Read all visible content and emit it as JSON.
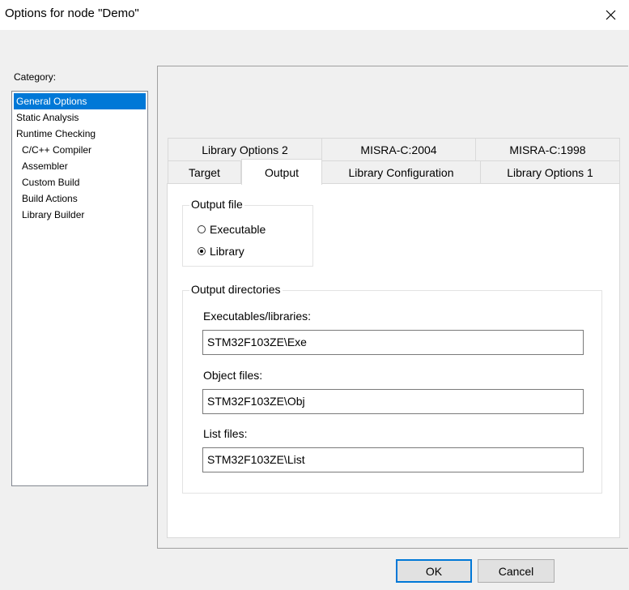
{
  "window": {
    "title": "Options for node \"Demo\""
  },
  "category": {
    "label": "Category:",
    "items": [
      {
        "label": "General Options",
        "selected": true
      },
      {
        "label": "Static Analysis"
      },
      {
        "label": "Runtime Checking"
      },
      {
        "label": "C/C++ Compiler"
      },
      {
        "label": "Assembler"
      },
      {
        "label": "Custom Build"
      },
      {
        "label": "Build Actions"
      },
      {
        "label": "Library Builder"
      }
    ]
  },
  "tabs": {
    "row_back": [
      "Library Options 2",
      "MISRA-C:2004",
      "MISRA-C:1998"
    ],
    "row_front": [
      "Target",
      "Output",
      "Library Configuration",
      "Library Options 1"
    ],
    "active": "Output"
  },
  "output_file": {
    "title": "Output file",
    "options": [
      "Executable",
      "Library"
    ],
    "selected": "Library"
  },
  "output_directories": {
    "title": "Output directories",
    "fields": [
      {
        "label": "Executables/libraries:",
        "value": "STM32F103ZE\\Exe"
      },
      {
        "label": "Object files:",
        "value": "STM32F103ZE\\Obj"
      },
      {
        "label": "List files:",
        "value": "STM32F103ZE\\List"
      }
    ]
  },
  "buttons": {
    "ok": "OK",
    "cancel": "Cancel"
  }
}
